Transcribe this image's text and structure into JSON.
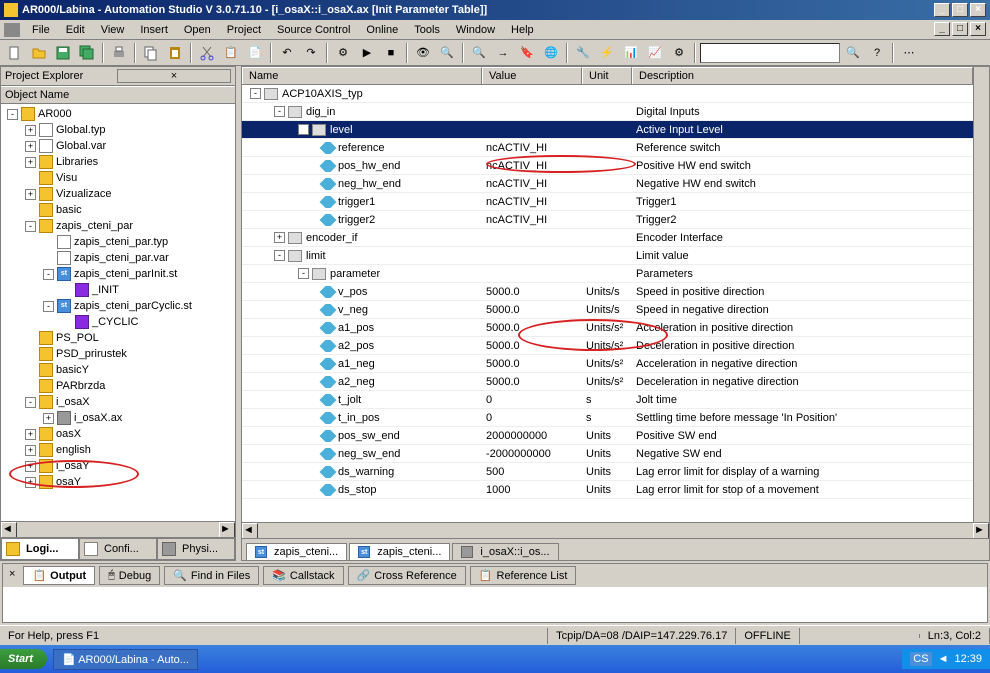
{
  "window": {
    "title": "AR000/Labina - Automation Studio V 3.0.71.10 - [i_osaX::i_osaX.ax [Init Parameter Table]]"
  },
  "menu": [
    "File",
    "Edit",
    "View",
    "Insert",
    "Open",
    "Project",
    "Source Control",
    "Online",
    "Tools",
    "Window",
    "Help"
  ],
  "explorer": {
    "title": "Project Explorer",
    "header": "Object Name",
    "tabs": [
      {
        "label": "Logi...",
        "active": true
      },
      {
        "label": "Confi...",
        "active": false
      },
      {
        "label": "Physi...",
        "active": false
      }
    ],
    "tree": [
      {
        "lvl": 0,
        "exp": "-",
        "icon": "folder",
        "label": "AR000"
      },
      {
        "lvl": 1,
        "exp": "+",
        "icon": "file",
        "label": "Global.typ"
      },
      {
        "lvl": 1,
        "exp": "+",
        "icon": "file",
        "label": "Global.var"
      },
      {
        "lvl": 1,
        "exp": "+",
        "icon": "folder",
        "label": "Libraries"
      },
      {
        "lvl": 1,
        "exp": "",
        "icon": "folder",
        "label": "Visu"
      },
      {
        "lvl": 1,
        "exp": "+",
        "icon": "folder",
        "label": "Vizualizace"
      },
      {
        "lvl": 1,
        "exp": "",
        "icon": "folder",
        "label": "basic"
      },
      {
        "lvl": 1,
        "exp": "-",
        "icon": "folder",
        "label": "zapis_cteni_par"
      },
      {
        "lvl": 2,
        "exp": "",
        "icon": "file",
        "label": "zapis_cteni_par.typ"
      },
      {
        "lvl": 2,
        "exp": "",
        "icon": "file",
        "label": "zapis_cteni_par.var"
      },
      {
        "lvl": 2,
        "exp": "-",
        "icon": "st",
        "label": "zapis_cteni_parInit.st"
      },
      {
        "lvl": 3,
        "exp": "",
        "icon": "purple",
        "label": "_INIT"
      },
      {
        "lvl": 2,
        "exp": "-",
        "icon": "st",
        "label": "zapis_cteni_parCyclic.st"
      },
      {
        "lvl": 3,
        "exp": "",
        "icon": "purple",
        "label": "_CYCLIC"
      },
      {
        "lvl": 1,
        "exp": "",
        "icon": "folder",
        "label": "PS_POL"
      },
      {
        "lvl": 1,
        "exp": "",
        "icon": "folder",
        "label": "PSD_prirustek"
      },
      {
        "lvl": 1,
        "exp": "",
        "icon": "folder",
        "label": "basicY"
      },
      {
        "lvl": 1,
        "exp": "",
        "icon": "folder",
        "label": "PARbrzda"
      },
      {
        "lvl": 1,
        "exp": "-",
        "icon": "folder",
        "label": "i_osaX"
      },
      {
        "lvl": 2,
        "exp": "+",
        "icon": "ax",
        "label": "i_osaX.ax"
      },
      {
        "lvl": 1,
        "exp": "+",
        "icon": "folder",
        "label": "oasX"
      },
      {
        "lvl": 1,
        "exp": "+",
        "icon": "folder",
        "label": "english"
      },
      {
        "lvl": 1,
        "exp": "+",
        "icon": "folder",
        "label": "i_osaY"
      },
      {
        "lvl": 1,
        "exp": "+",
        "icon": "folder",
        "label": "osaY"
      }
    ]
  },
  "grid": {
    "columns": [
      "Name",
      "Value",
      "Unit",
      "Description"
    ],
    "rows": [
      {
        "lvl": 0,
        "exp": "-",
        "type": "struct",
        "name": "ACP10AXIS_typ",
        "value": "",
        "unit": "",
        "desc": ""
      },
      {
        "lvl": 1,
        "exp": "-",
        "type": "struct",
        "name": "dig_in",
        "value": "",
        "unit": "",
        "desc": "Digital Inputs"
      },
      {
        "lvl": 2,
        "exp": "-",
        "type": "struct",
        "name": "level",
        "value": "",
        "unit": "",
        "desc": "Active Input Level",
        "selected": true
      },
      {
        "lvl": 3,
        "exp": "",
        "type": "param",
        "name": "reference",
        "value": "ncACTIV_HI",
        "unit": "",
        "desc": "Reference switch"
      },
      {
        "lvl": 3,
        "exp": "",
        "type": "param",
        "name": "pos_hw_end",
        "value": "ncACTIV_HI",
        "unit": "",
        "desc": "Positive HW end switch"
      },
      {
        "lvl": 3,
        "exp": "",
        "type": "param",
        "name": "neg_hw_end",
        "value": "ncACTIV_HI",
        "unit": "",
        "desc": "Negative HW end switch"
      },
      {
        "lvl": 3,
        "exp": "",
        "type": "param",
        "name": "trigger1",
        "value": "ncACTIV_HI",
        "unit": "",
        "desc": "Trigger1"
      },
      {
        "lvl": 3,
        "exp": "",
        "type": "param",
        "name": "trigger2",
        "value": "ncACTIV_HI",
        "unit": "",
        "desc": "Trigger2"
      },
      {
        "lvl": 1,
        "exp": "+",
        "type": "struct",
        "name": "encoder_if",
        "value": "",
        "unit": "",
        "desc": "Encoder Interface"
      },
      {
        "lvl": 1,
        "exp": "-",
        "type": "struct",
        "name": "limit",
        "value": "",
        "unit": "",
        "desc": "Limit value"
      },
      {
        "lvl": 2,
        "exp": "-",
        "type": "struct",
        "name": "parameter",
        "value": "",
        "unit": "",
        "desc": "Parameters"
      },
      {
        "lvl": 3,
        "exp": "",
        "type": "param",
        "name": "v_pos",
        "value": "5000.0",
        "unit": "Units/s",
        "desc": "Speed in positive direction"
      },
      {
        "lvl": 3,
        "exp": "",
        "type": "param",
        "name": "v_neg",
        "value": "5000.0",
        "unit": "Units/s",
        "desc": "Speed in negative direction"
      },
      {
        "lvl": 3,
        "exp": "",
        "type": "param",
        "name": "a1_pos",
        "value": "5000.0",
        "unit": "Units/s²",
        "desc": "Acceleration in positive direction"
      },
      {
        "lvl": 3,
        "exp": "",
        "type": "param",
        "name": "a2_pos",
        "value": "5000.0",
        "unit": "Units/s²",
        "desc": "Deceleration in positive direction"
      },
      {
        "lvl": 3,
        "exp": "",
        "type": "param",
        "name": "a1_neg",
        "value": "5000.0",
        "unit": "Units/s²",
        "desc": "Acceleration in negative direction"
      },
      {
        "lvl": 3,
        "exp": "",
        "type": "param",
        "name": "a2_neg",
        "value": "5000.0",
        "unit": "Units/s²",
        "desc": "Deceleration in negative direction"
      },
      {
        "lvl": 3,
        "exp": "",
        "type": "param",
        "name": "t_jolt",
        "value": "0",
        "unit": "s",
        "desc": "Jolt time"
      },
      {
        "lvl": 3,
        "exp": "",
        "type": "param",
        "name": "t_in_pos",
        "value": "0",
        "unit": "s",
        "desc": "Settling time before message 'In Position'"
      },
      {
        "lvl": 3,
        "exp": "",
        "type": "param",
        "name": "pos_sw_end",
        "value": "2000000000",
        "unit": "Units",
        "desc": "Positive SW end"
      },
      {
        "lvl": 3,
        "exp": "",
        "type": "param",
        "name": "neg_sw_end",
        "value": "-2000000000",
        "unit": "Units",
        "desc": "Negative SW end"
      },
      {
        "lvl": 3,
        "exp": "",
        "type": "param",
        "name": "ds_warning",
        "value": "500",
        "unit": "Units",
        "desc": "Lag error limit for display of a warning"
      },
      {
        "lvl": 3,
        "exp": "",
        "type": "param",
        "name": "ds_stop",
        "value": "1000",
        "unit": "Units",
        "desc": "Lag error limit for stop of a movement"
      }
    ]
  },
  "content_tabs": [
    {
      "label": "zapis_cteni..."
    },
    {
      "label": "zapis_cteni..."
    },
    {
      "label": "i_osaX::i_os...",
      "active": true
    }
  ],
  "output_tabs": [
    {
      "label": "Output",
      "active": true
    },
    {
      "label": "Debug"
    },
    {
      "label": "Find in Files"
    },
    {
      "label": "Callstack"
    },
    {
      "label": "Cross Reference"
    },
    {
      "label": "Reference List"
    }
  ],
  "status": {
    "help": "For Help, press F1",
    "conn": "Tcpip/DA=08 /DAIP=147.229.76.17",
    "state": "OFFLINE",
    "pos": "Ln:3, Col:2"
  },
  "taskbar": {
    "start": "Start",
    "task": "AR000/Labina - Auto...",
    "lang": "CS",
    "time": "12:39"
  }
}
